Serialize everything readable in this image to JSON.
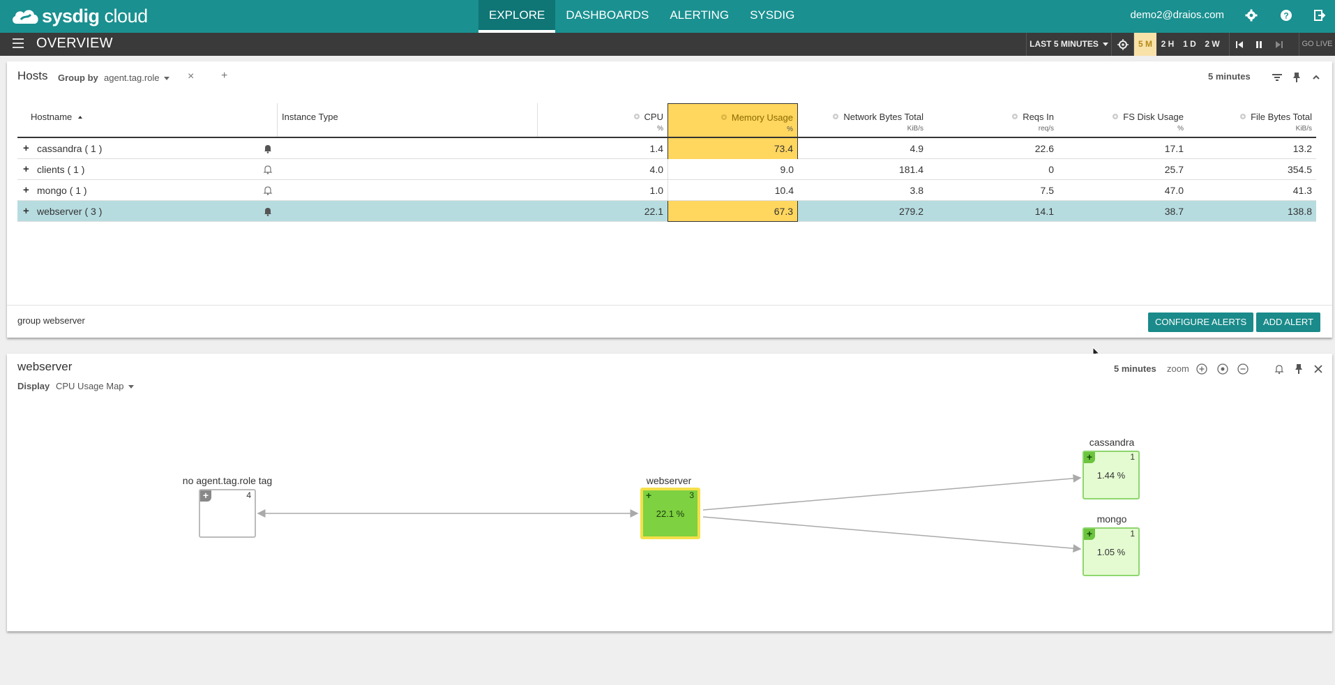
{
  "brand": {
    "name_bold": "sysdig",
    "name_light": " cloud"
  },
  "nav": {
    "items": [
      "EXPLORE",
      "DASHBOARDS",
      "ALERTING",
      "SYSDIG"
    ],
    "active": "EXPLORE"
  },
  "user": {
    "email": "demo2@draios.com"
  },
  "subbar": {
    "title": "OVERVIEW",
    "time_range": "LAST 5 MINUTES",
    "presets": [
      "5 M",
      "2 H",
      "1 D",
      "2 W"
    ],
    "selected_preset": "5 M",
    "go_live": "GO LIVE"
  },
  "hosts_panel": {
    "title": "Hosts",
    "group_by_label": "Group by",
    "group_by_value": "agent.tag.role",
    "add_symbol": "+",
    "remove_symbol": "×",
    "time": "5 minutes",
    "columns": [
      {
        "title": "Hostname",
        "unit": ""
      },
      {
        "title": "Instance Type",
        "unit": ""
      },
      {
        "title": "CPU",
        "unit": "%"
      },
      {
        "title": "Memory Usage",
        "unit": "%"
      },
      {
        "title": "Network Bytes Total",
        "unit": "KiB/s"
      },
      {
        "title": "Reqs In",
        "unit": "req/s"
      },
      {
        "title": "FS Disk Usage",
        "unit": "%"
      },
      {
        "title": "File Bytes Total",
        "unit": "KiB/s"
      }
    ],
    "rows": [
      {
        "name": "cassandra ( 1 )",
        "alert": true,
        "cpu": "1.4",
        "mem": "73.4",
        "net": "4.9",
        "reqs": "22.6",
        "fs": "17.1",
        "file": "13.2"
      },
      {
        "name": "clients ( 1 )",
        "alert": false,
        "cpu": "4.0",
        "mem": "9.0",
        "net": "181.4",
        "reqs": "0",
        "fs": "25.7",
        "file": "354.5"
      },
      {
        "name": "mongo ( 1 )",
        "alert": false,
        "cpu": "1.0",
        "mem": "10.4",
        "net": "3.8",
        "reqs": "7.5",
        "fs": "47.0",
        "file": "41.3"
      },
      {
        "name": "webserver ( 3 )",
        "alert": true,
        "cpu": "22.1",
        "mem": "67.3",
        "net": "279.2",
        "reqs": "14.1",
        "fs": "38.7",
        "file": "138.8"
      }
    ],
    "row_expand_symbol": "+",
    "highlighted_rows": [
      0,
      3
    ],
    "selected_row": 3,
    "footer_text": "group webserver",
    "configure_alerts_label": "CONFIGURE ALERTS",
    "add_alert_label": "ADD ALERT"
  },
  "map_panel": {
    "title": "webserver",
    "display_label": "Display",
    "display_value": "CPU Usage Map",
    "time": "5 minutes",
    "zoom_label": "zoom",
    "nodes": [
      {
        "label": "no agent.tag.role tag",
        "count": "4",
        "value": "",
        "plus": "+"
      },
      {
        "label": "webserver",
        "count": "3",
        "value": "22.1 %",
        "plus": "+"
      },
      {
        "label": "cassandra",
        "count": "1",
        "value": "1.44 %",
        "plus": "+"
      },
      {
        "label": "mongo",
        "count": "1",
        "value": "1.05 %",
        "plus": "+"
      }
    ]
  },
  "colors": {
    "teal": "#1a9090",
    "dark_bar": "#3a3a3a",
    "highlight": "#ffd65e",
    "selected_row": "#b7dce0",
    "node_green": "#7ed140",
    "node_light": "#e4fbd1"
  }
}
